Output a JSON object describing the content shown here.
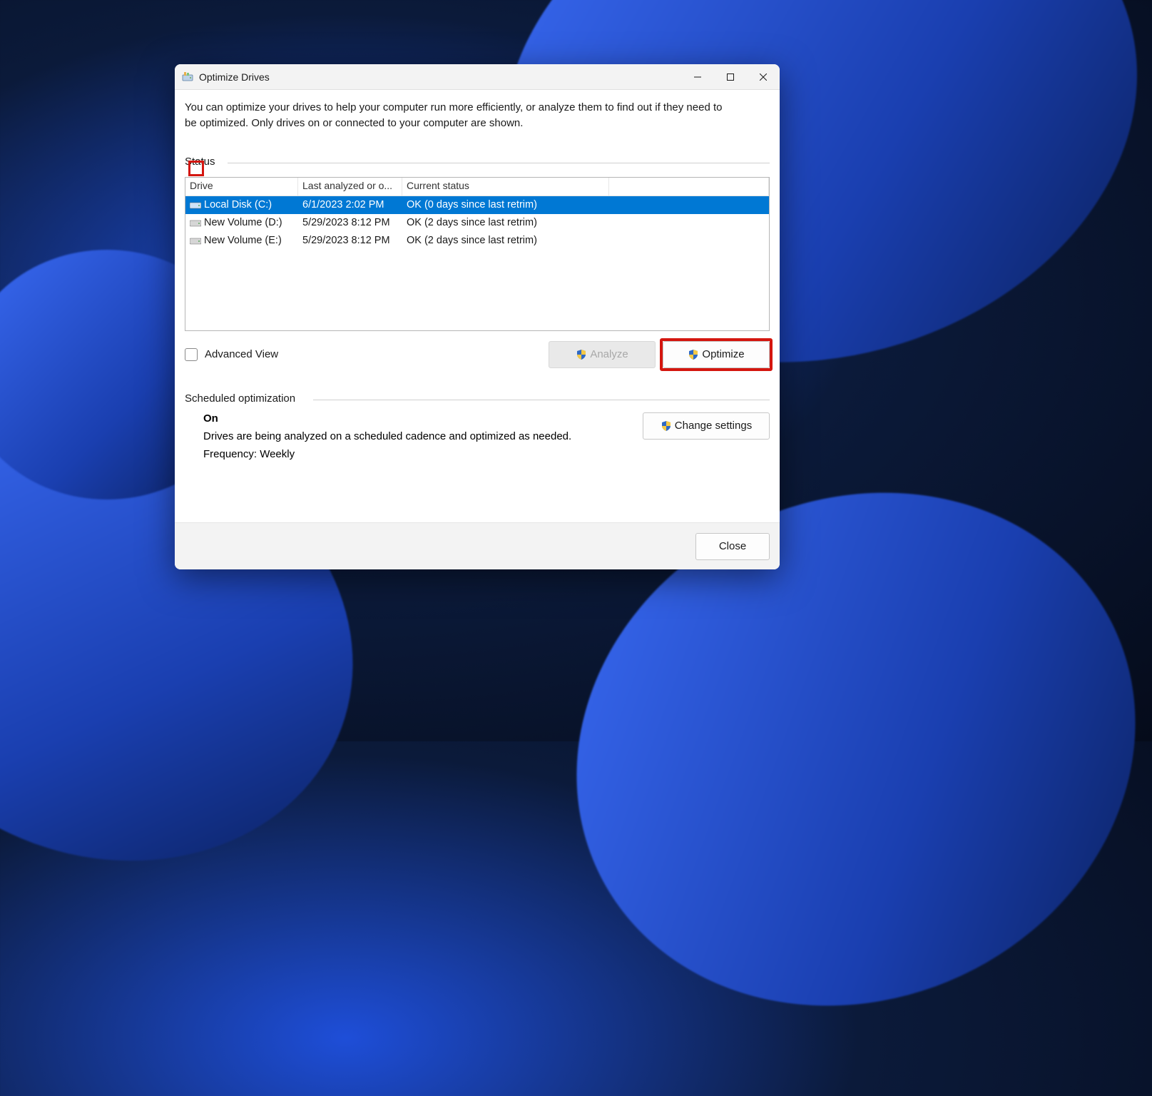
{
  "window": {
    "title": "Optimize Drives",
    "description": "You can optimize your drives to help your computer run more efficiently, or analyze them to find out if they need to be optimized. Only drives on or connected to your computer are shown."
  },
  "status_group": {
    "label": "Status",
    "columns": {
      "drive": "Drive",
      "last": "Last analyzed or o...",
      "current": "Current status"
    },
    "rows": [
      {
        "name": "Local Disk (C:)",
        "last": "6/1/2023 2:02 PM",
        "status": "OK (0 days since last retrim)",
        "selected": true
      },
      {
        "name": "New Volume (D:)",
        "last": "5/29/2023 8:12 PM",
        "status": "OK (2 days since last retrim)",
        "selected": false
      },
      {
        "name": "New Volume (E:)",
        "last": "5/29/2023 8:12 PM",
        "status": "OK (2 days since last retrim)",
        "selected": false
      }
    ]
  },
  "advanced_view_label": "Advanced View",
  "buttons": {
    "analyze": "Analyze",
    "optimize": "Optimize",
    "change_settings": "Change settings",
    "close": "Close"
  },
  "scheduled": {
    "label": "Scheduled optimization",
    "state": "On",
    "desc": "Drives are being analyzed on a scheduled cadence and optimized as needed.",
    "frequency": "Frequency: Weekly"
  }
}
